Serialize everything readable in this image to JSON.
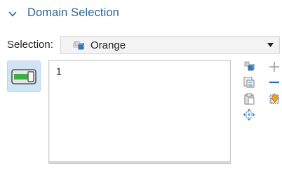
{
  "section": {
    "title": "Domain Selection",
    "chevron_icon": "chevron-down-icon"
  },
  "selection": {
    "label": "Selection:",
    "value": "Orange",
    "value_icon": "selection-node-icon",
    "arrow_icon": "triangle-down-icon"
  },
  "active_toggle": {
    "icon": "toggle-active-icon",
    "accent": "#3cb043"
  },
  "list": {
    "items": [
      "1"
    ]
  },
  "toolbar": {
    "icons": [
      "copy-selection-icon",
      "paste-selection-list-icon",
      "paste-icon",
      "zoom-to-selection-icon",
      "add-icon",
      "remove-icon",
      "clear-selection-icon"
    ]
  },
  "colors": {
    "header_text": "#2a6496",
    "accent_blue": "#1f6fb5",
    "toggle_bg": "#cfe4f4"
  }
}
